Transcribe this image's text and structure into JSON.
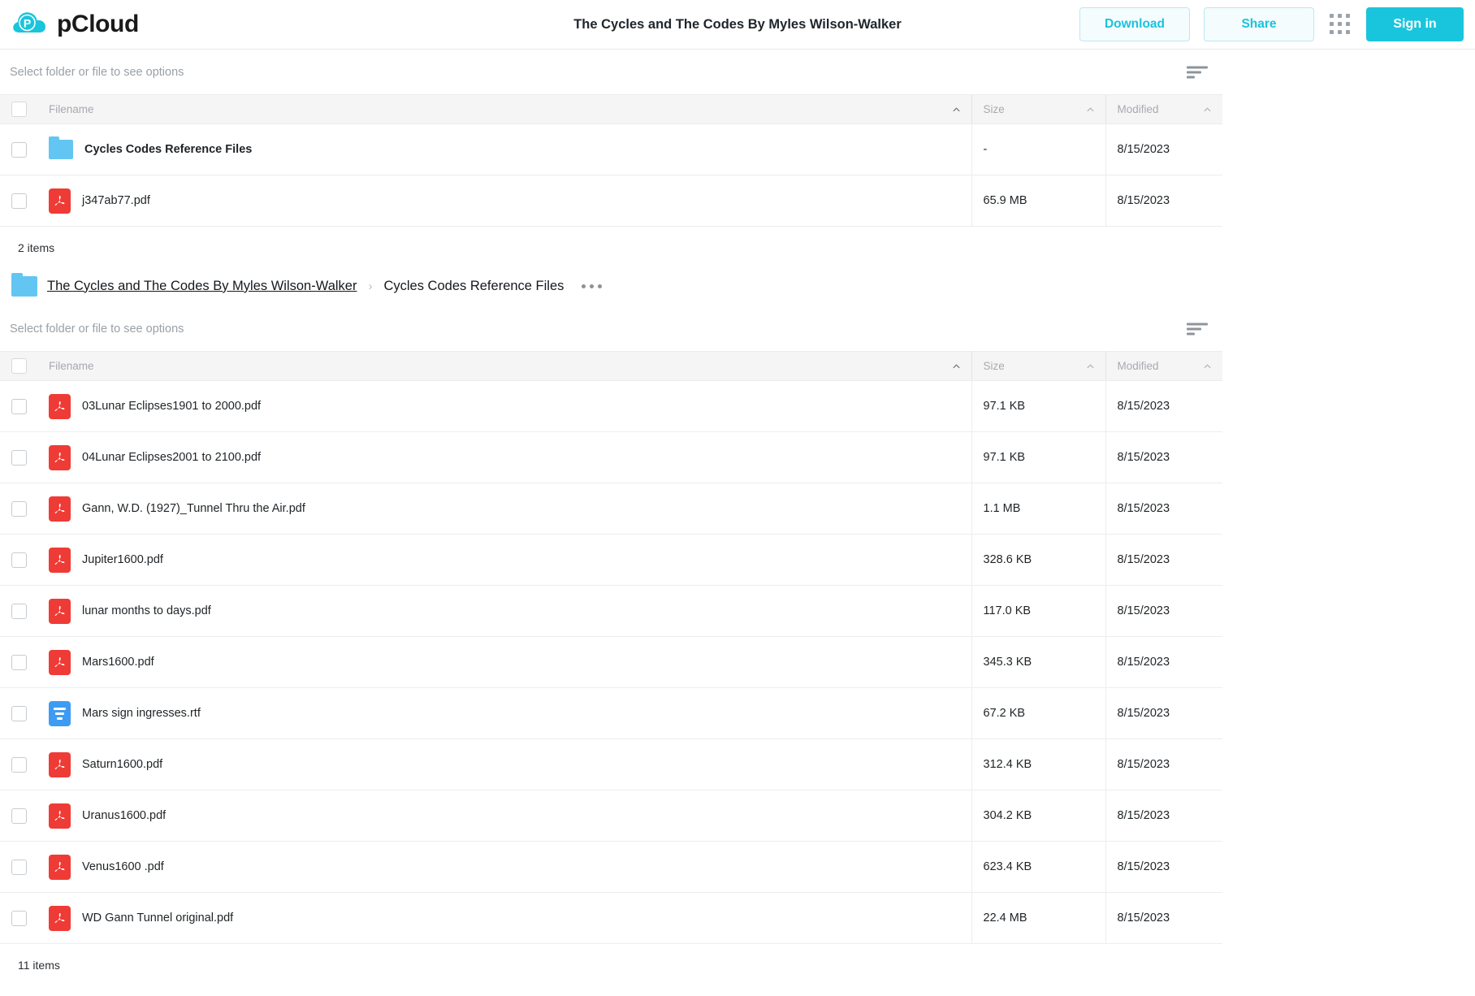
{
  "header": {
    "brand": "pCloud",
    "logo_icon": "pcloud-logo-icon",
    "doc_title": "The Cycles and The Codes By Myles Wilson-Walker",
    "download_label": "Download",
    "share_label": "Share",
    "apps_grid_icon": "apps-grid-icon",
    "signin_label": "Sign in",
    "accent_color": "#19c5dc",
    "outline_bg": "#f5fcfe"
  },
  "section1": {
    "toolbar_hint": "Select folder or file to see options",
    "sort_icon": "sort-lines-icon",
    "columns": {
      "filename": "Filename",
      "size": "Size",
      "modified": "Modified"
    },
    "rows": [
      {
        "icon": "folder-icon",
        "type": "folder",
        "name": "Cycles Codes Reference Files",
        "size": "-",
        "modified": "8/15/2023"
      },
      {
        "icon": "pdf-file-icon",
        "type": "pdf",
        "name": "j347ab77.pdf",
        "size": "65.9 MB",
        "modified": "8/15/2023"
      }
    ],
    "items_count": "2 items"
  },
  "breadcrumb": {
    "folder_icon": "folder-icon",
    "root": "The Cycles and The Codes By Myles Wilson-Walker",
    "separator": "›",
    "current": "Cycles Codes Reference Files",
    "more_icon": "more-options-icon"
  },
  "section2": {
    "toolbar_hint": "Select folder or file to see options",
    "sort_icon": "sort-lines-icon",
    "columns": {
      "filename": "Filename",
      "size": "Size",
      "modified": "Modified"
    },
    "rows": [
      {
        "icon": "pdf-file-icon",
        "type": "pdf",
        "name": "03Lunar Eclipses1901 to 2000.pdf",
        "size": "97.1 KB",
        "modified": "8/15/2023"
      },
      {
        "icon": "pdf-file-icon",
        "type": "pdf",
        "name": "04Lunar Eclipses2001 to 2100.pdf",
        "size": "97.1 KB",
        "modified": "8/15/2023"
      },
      {
        "icon": "pdf-file-icon",
        "type": "pdf",
        "name": "Gann, W.D. (1927)_Tunnel Thru the Air.pdf",
        "size": "1.1 MB",
        "modified": "8/15/2023"
      },
      {
        "icon": "pdf-file-icon",
        "type": "pdf",
        "name": "Jupiter1600.pdf",
        "size": "328.6 KB",
        "modified": "8/15/2023"
      },
      {
        "icon": "pdf-file-icon",
        "type": "pdf",
        "name": "lunar months to days.pdf",
        "size": "117.0 KB",
        "modified": "8/15/2023"
      },
      {
        "icon": "pdf-file-icon",
        "type": "pdf",
        "name": "Mars1600.pdf",
        "size": "345.3 KB",
        "modified": "8/15/2023"
      },
      {
        "icon": "rtf-file-icon",
        "type": "rtf",
        "name": "Mars sign ingresses.rtf",
        "size": "67.2 KB",
        "modified": "8/15/2023"
      },
      {
        "icon": "pdf-file-icon",
        "type": "pdf",
        "name": "Saturn1600.pdf",
        "size": "312.4 KB",
        "modified": "8/15/2023"
      },
      {
        "icon": "pdf-file-icon",
        "type": "pdf",
        "name": "Uranus1600.pdf",
        "size": "304.2 KB",
        "modified": "8/15/2023"
      },
      {
        "icon": "pdf-file-icon",
        "type": "pdf",
        "name": "Venus1600 .pdf",
        "size": "623.4 KB",
        "modified": "8/15/2023"
      },
      {
        "icon": "pdf-file-icon",
        "type": "pdf",
        "name": "WD Gann Tunnel original.pdf",
        "size": "22.4 MB",
        "modified": "8/15/2023"
      }
    ],
    "items_count": "11 items"
  }
}
